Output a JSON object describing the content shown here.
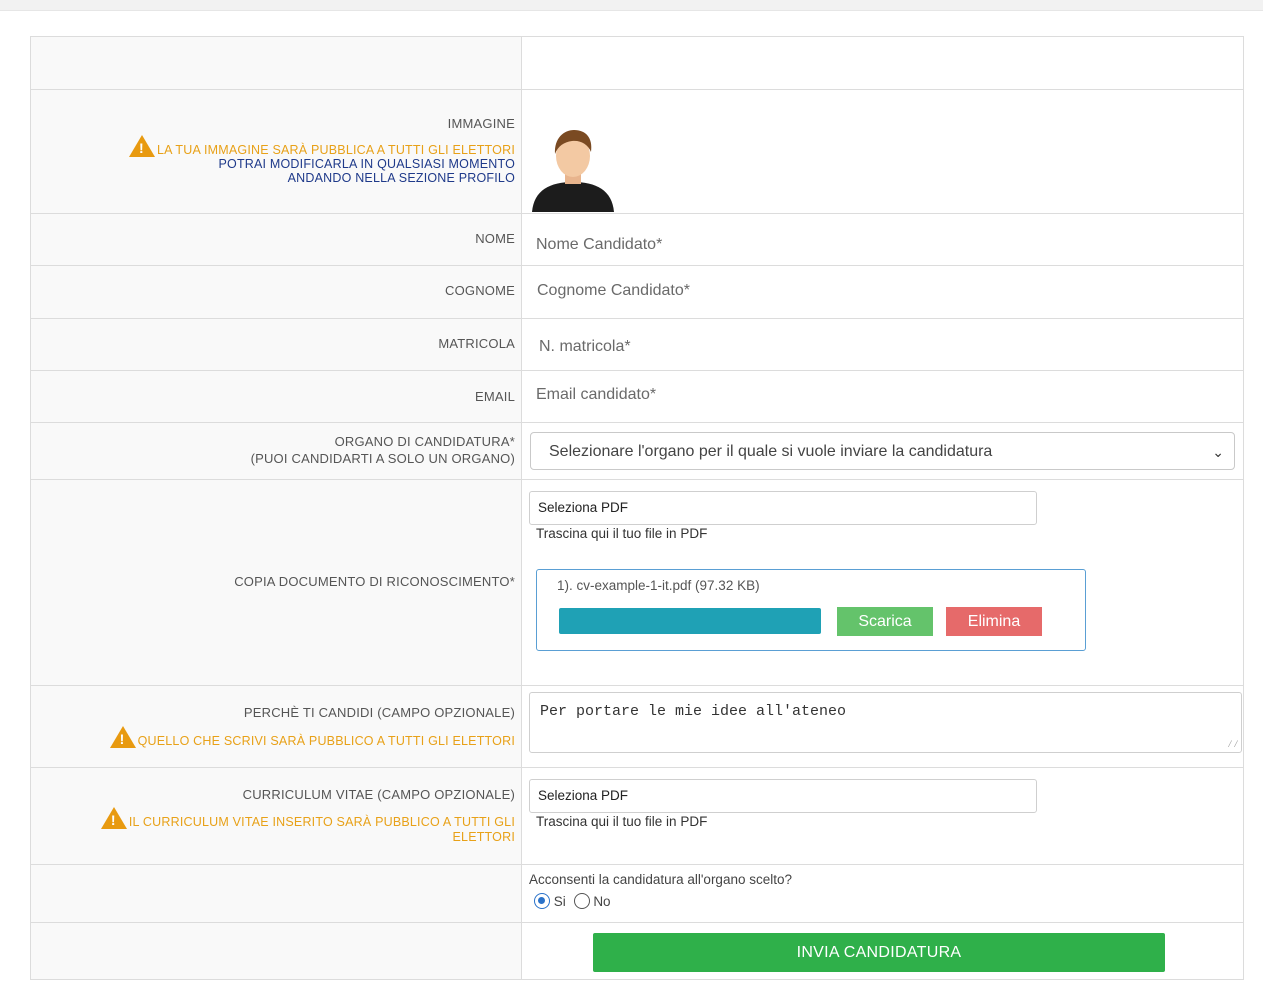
{
  "form": {
    "immagine": {
      "label": "IMMAGINE",
      "warning": "LA TUA IMMAGINE SARÀ PUBBLICA A TUTTI GLI ELETTORI",
      "note": "POTRAI MODIFICARLA IN QUALSIASI MOMENTO ANDANDO NELLA SEZIONE PROFILO"
    },
    "nome": {
      "label": "NOME",
      "placeholder": "Nome Candidato*"
    },
    "cognome": {
      "label": "COGNOME",
      "placeholder": "Cognome Candidato*"
    },
    "matricola": {
      "label": "MATRICOLA",
      "placeholder": "N. matricola*"
    },
    "email": {
      "label": "EMAIL",
      "placeholder": "Email candidato*"
    },
    "organo": {
      "label": "ORGANO DI CANDIDATURA*",
      "sublabel": "(PUOI CANDIDARTI A SOLO UN ORGANO)",
      "selected": "Selezionare l'organo per il quale si vuole inviare la candidatura"
    },
    "documento": {
      "label": "COPIA DOCUMENTO DI RICONOSCIMENTO*",
      "file_button": "Seleziona PDF",
      "drag_hint": "Trascina qui il tuo file in PDF",
      "uploaded_file": "1). cv-example-1-it.pdf (97.32 KB)",
      "progress": 1.0,
      "download_label": "Scarica",
      "delete_label": "Elimina"
    },
    "perche": {
      "label": "PERCHÈ TI CANDIDI (CAMPO OPZIONALE)",
      "warning": "QUELLO CHE SCRIVI SARÀ PUBBLICO A TUTTI GLI ELETTORI",
      "value": "Per portare le mie idee all'ateneo"
    },
    "curriculum": {
      "label": "CURRICULUM VITAE (CAMPO OPZIONALE)",
      "warning": "IL CURRICULUM VITAE INSERITO SARÀ PUBBLICO A TUTTI GLI ELETTORI",
      "file_button": "Seleziona PDF",
      "drag_hint": "Trascina qui il tuo file in PDF"
    },
    "consenso": {
      "question": "Acconsenti la candidatura all'organo scelto?",
      "yes": "Si",
      "no": "No",
      "selected": "Si"
    },
    "submit_label": "INVIA CANDIDATURA"
  }
}
